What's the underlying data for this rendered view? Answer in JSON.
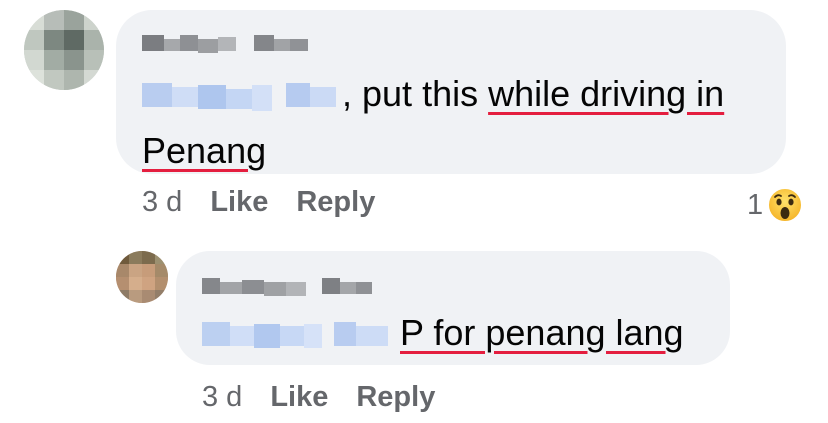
{
  "comments": [
    {
      "text_mention_sep": ",",
      "text_plain": " put this ",
      "text_underlined_1": "while driving in",
      "text_underlined_2": "Penang",
      "time": "3 d",
      "like_label": "Like",
      "reply_label": "Reply",
      "reaction_count": "1",
      "reaction_icon": "wow-emoji-icon"
    },
    {
      "text_underlined": "P for penang lang",
      "time": "3 d",
      "like_label": "Like",
      "reply_label": "Reply"
    }
  ],
  "colors": {
    "bubble": "#f0f2f5",
    "meta_text": "#65676b",
    "underline": "#e41e3f",
    "mention_blur": "#c7d8f5"
  }
}
